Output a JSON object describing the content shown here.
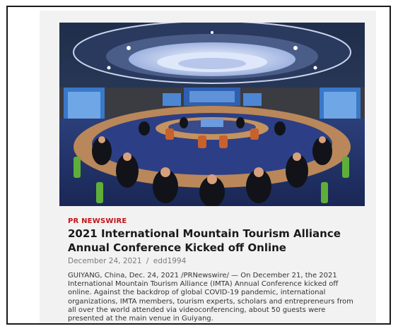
{
  "article": {
    "source": "PR NEWSWIRE",
    "headline": "2021 International Mountain Tourism Alliance Annual Conference Kicked off Online",
    "date": "December 24, 2021",
    "separator": "/",
    "author": "edd1994",
    "body": "GUIYANG, China, Dec. 24, 2021 /PRNewswire/ — On December 21, the 2021 International Mountain Tourism Alliance (IMTA) Annual Conference kicked off online. Against the backdrop of global COVID-19 pandemic, international organizations, IMTA members, tourism experts, scholars and entrepreneurs from all over the world attended via videoconferencing, about 50 guests were presented at the main venue in Guiyang."
  },
  "colors": {
    "source_accent": "#c0151a",
    "card_background": "#f2f2f2",
    "frame_border": "#1a1a1a"
  }
}
